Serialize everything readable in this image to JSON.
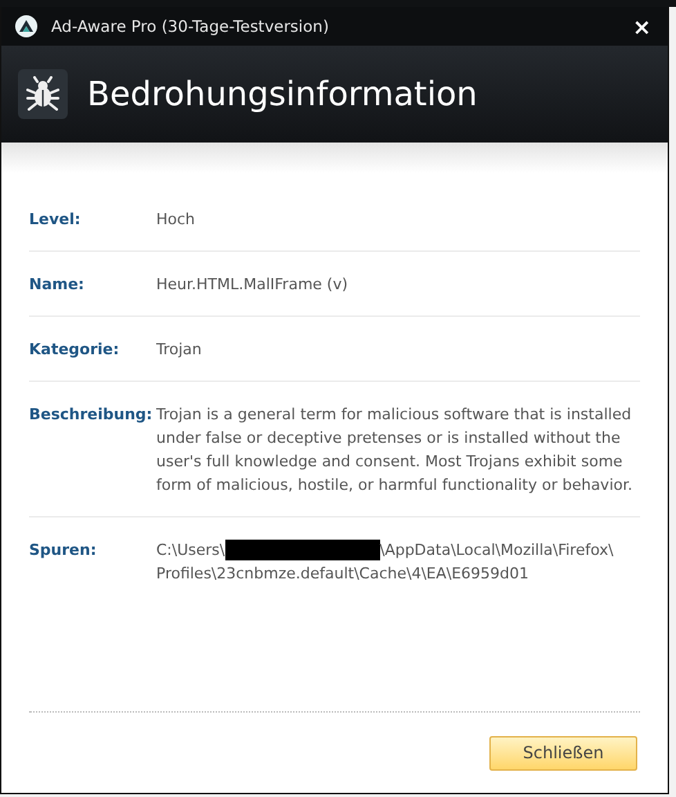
{
  "window": {
    "title": "Ad-Aware Pro (30-Tage-Testversion)",
    "close": "×"
  },
  "header": {
    "title": "Bedrohungsinformation"
  },
  "details": [
    {
      "kind": "text",
      "label": "Level:",
      "value": "Hoch"
    },
    {
      "kind": "text",
      "label": "Name:",
      "value": "Heur.HTML.MalIFrame (v)"
    },
    {
      "kind": "text",
      "label": "Kategorie:",
      "value": "Trojan"
    },
    {
      "kind": "text",
      "label": "Beschreibung:",
      "value": "Trojan is a general term for malicious software that is installed under false or deceptive pretenses or is installed without the user's full knowledge and consent. Most Trojans exhibit some form of malicious, hostile, or harmful functionality or behavior."
    },
    {
      "kind": "path",
      "label": "Spuren:",
      "segments": [
        "C:\\Users\\",
        "\\AppData\\Local\\Mozilla\\Firefox\\",
        "Profiles\\23cnbmze.default\\Cache\\4\\EA\\E6959d01"
      ],
      "redacted": true
    }
  ],
  "buttons": [
    "Schließen"
  ]
}
